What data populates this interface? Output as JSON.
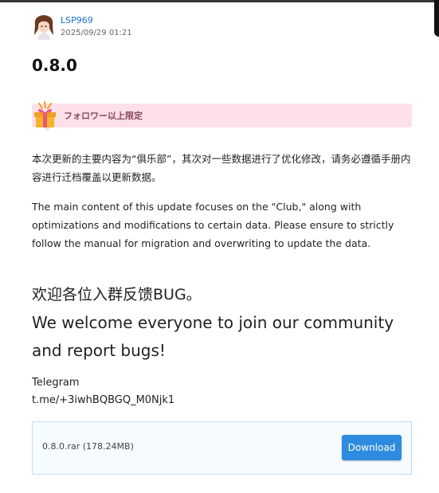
{
  "author": {
    "name": "LSP969",
    "date": "2025/09/29 01:21"
  },
  "post": {
    "title": "0.8.0"
  },
  "limit_banner": {
    "text": "フォロワー以上限定"
  },
  "content": {
    "paragraph_cn": "本次更新的主要内容为“俱乐部”，其次对一些数据进行了优化修改，请务必遵循手册内容进行迁档覆盖以更新数据。",
    "paragraph_en": "The main content of this update focuses on the \"Club,\" along with optimizations and modifications to certain data. Please ensure to strictly follow the manual for migration and overwriting to update the data.",
    "headline_cn": "欢迎各位入群反馈BUG。",
    "headline_en": "We welcome everyone to join our community and report bugs!",
    "telegram_label": "Telegram",
    "telegram_link": "t.me/+3iwhBQBGQ_M0Njk1"
  },
  "download": {
    "file_label": "0.8.0.rar (178.24MB)",
    "button_label": "Download"
  },
  "colors": {
    "link": "#1a73c9",
    "banner_bg": "#fde0e8",
    "button": "#2d8cdf",
    "box_border": "#bfe0f0"
  },
  "icons": {
    "avatar": "user-avatar",
    "gift": "gift-icon"
  }
}
